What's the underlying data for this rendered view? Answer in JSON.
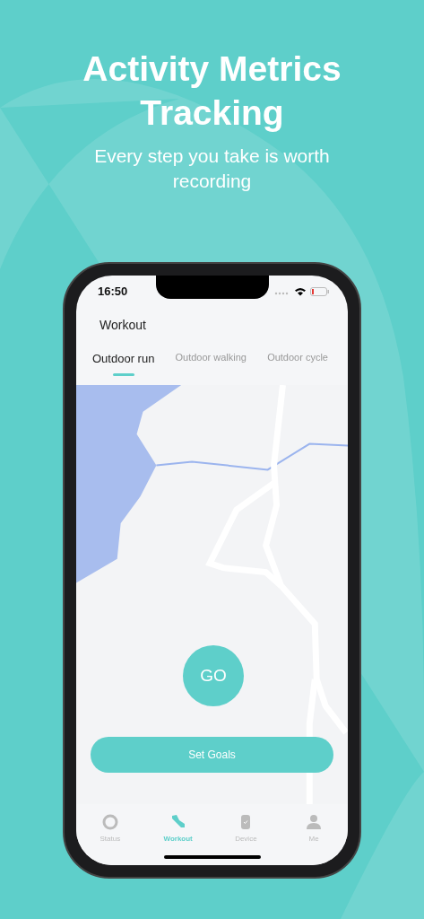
{
  "headline": {
    "title": "Activity Metrics Tracking",
    "subtitle": "Every step you take is worth recording"
  },
  "status_bar": {
    "time": "16:50"
  },
  "header": {
    "title": "Workout"
  },
  "tabs": [
    {
      "label": "Outdoor run",
      "selected": true
    },
    {
      "label": "Outdoor walking",
      "selected": false
    },
    {
      "label": "Outdoor cycle",
      "selected": false
    }
  ],
  "go_button": {
    "label": "GO"
  },
  "goals_button": {
    "label": "Set Goals"
  },
  "bottom_nav": [
    {
      "label": "Status",
      "kind": "ring",
      "selected": false
    },
    {
      "label": "Workout",
      "kind": "shoe",
      "selected": true
    },
    {
      "label": "Device",
      "kind": "watch",
      "selected": false
    },
    {
      "label": "Me",
      "kind": "person",
      "selected": false
    }
  ]
}
